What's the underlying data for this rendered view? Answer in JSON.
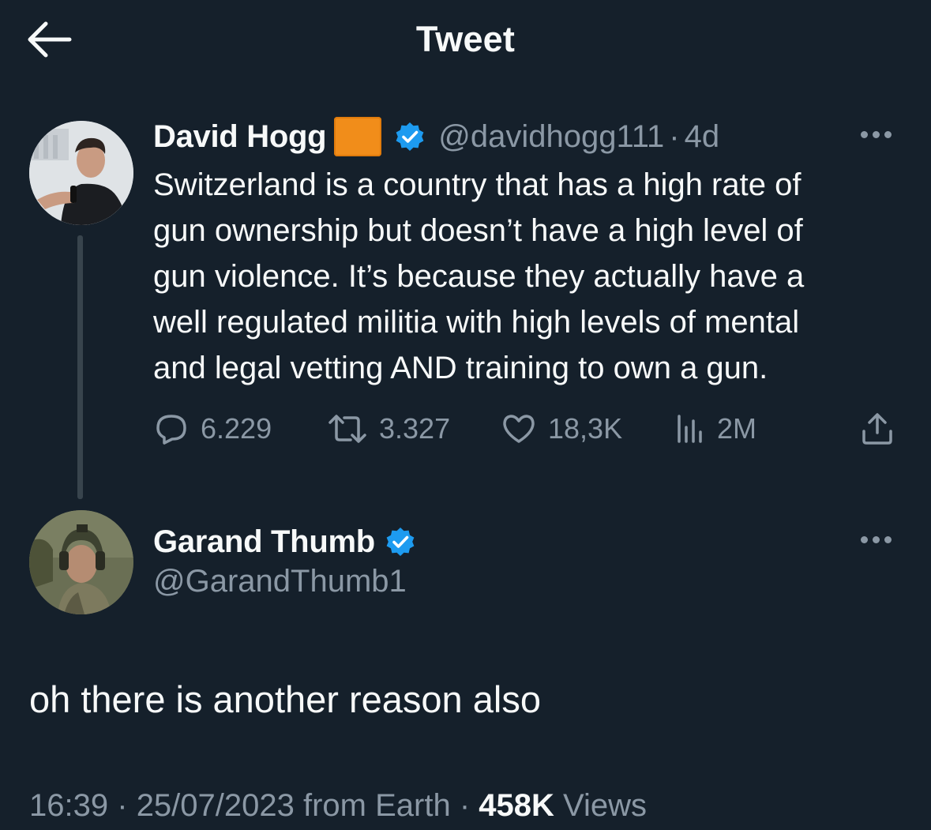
{
  "header": {
    "title": "Tweet"
  },
  "original_tweet": {
    "author_name": "David Hogg",
    "author_handle": "@davidhogg111",
    "separator": "·",
    "time_ago": "4d",
    "badge_color": "#f18d1a",
    "verified": true,
    "text_lines": [
      "Switzerland is a country that has a high rate of",
      "gun ownership but doesn’t have a high level of",
      "gun violence. It’s because they actually have a",
      "well regulated militia with high levels of mental",
      "and legal vetting AND training to own a gun."
    ],
    "stats": {
      "replies": "6.229",
      "retweets": "3.327",
      "likes": "18,3K",
      "views": "2M"
    }
  },
  "reply_tweet": {
    "author_name": "Garand Thumb",
    "author_handle": "@GarandThumb1",
    "verified": true,
    "text": "oh there is another reason also",
    "timestamp_time": "16:39",
    "separator": "·",
    "timestamp_date": "25/07/2023 from Earth",
    "views_count": "458K",
    "views_label": "Views"
  },
  "colors": {
    "background": "#15202b",
    "text_primary": "#f7f9f9",
    "text_secondary": "#8b98a5",
    "verified_blue": "#1d9bf0",
    "thread_line": "#38444d"
  },
  "icons": {
    "back": "arrow-left-icon",
    "more": "more-horizontal-icon",
    "verified": "verified-badge-icon",
    "reply": "reply-bubble-icon",
    "retweet": "retweet-icon",
    "like": "heart-icon",
    "views": "bar-chart-icon",
    "share": "share-upload-icon"
  }
}
